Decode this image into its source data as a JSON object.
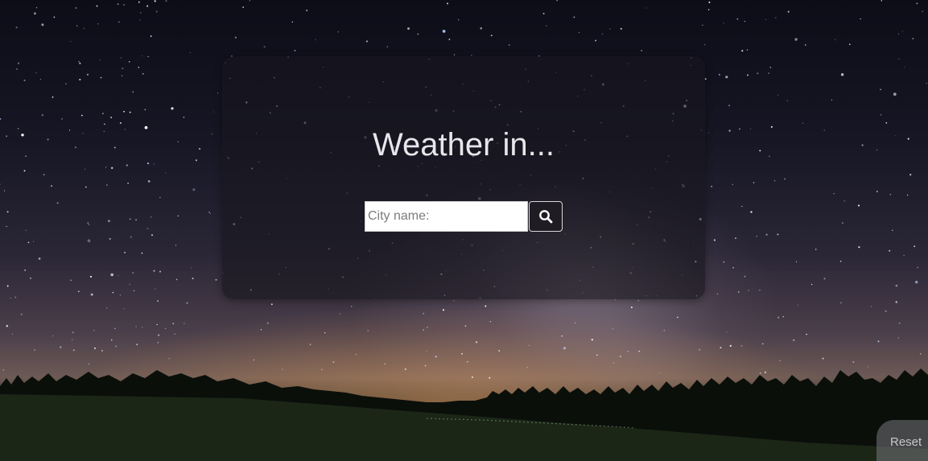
{
  "background": {
    "description_icon": "night-sky-icon"
  },
  "card": {
    "title": "Weather in...",
    "search": {
      "placeholder": "City name:",
      "value": "",
      "button_icon": "search-icon"
    }
  },
  "reset": {
    "label": "Reset"
  },
  "colors": {
    "card_bg": "#19161e",
    "title_text": "#e8e6ea",
    "button_bg": "#1f1c24",
    "button_border": "#d8d8d8"
  }
}
